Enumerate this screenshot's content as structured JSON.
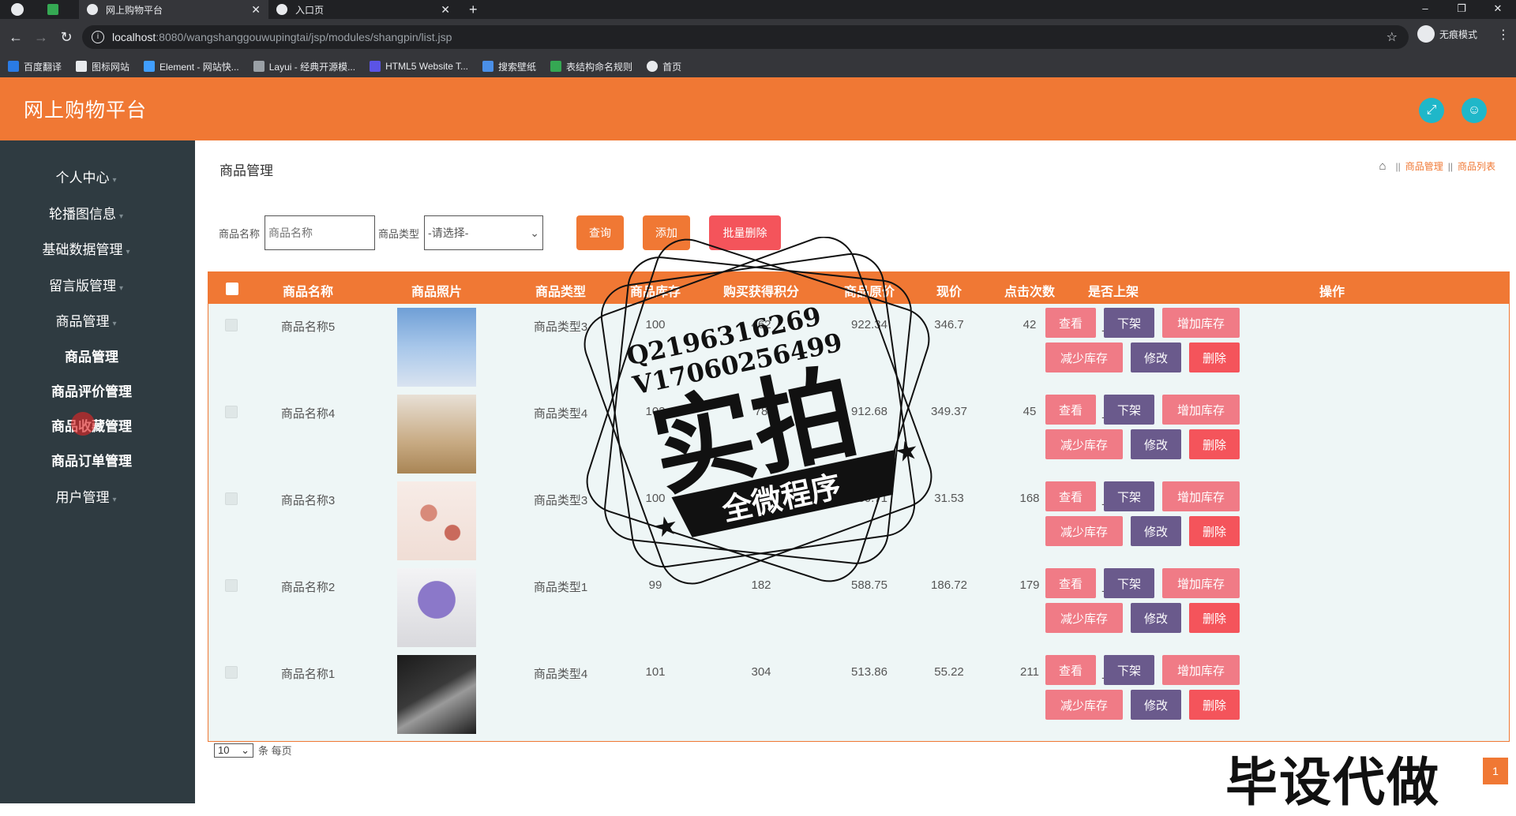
{
  "browser": {
    "tabs": [
      {
        "title": "网上购物平台",
        "active": true
      },
      {
        "title": "入口页",
        "active": false
      }
    ],
    "url_host": "localhost",
    "url_path": ":8080/wangshanggouwupingtai/jsp/modules/shangpin/list.jsp",
    "incognito_label": "无痕模式",
    "bookmarks": [
      "百度翻译",
      "图标网站",
      "Element - 网站快...",
      "Layui - 经典开源模...",
      "HTML5 Website T...",
      "搜索壁纸",
      "表结构命名规则",
      "首页"
    ]
  },
  "app": {
    "title": "网上购物平台"
  },
  "sidebar": {
    "items": [
      {
        "label": "个人中心"
      },
      {
        "label": "轮播图信息"
      },
      {
        "label": "基础数据管理"
      },
      {
        "label": "留言版管理"
      },
      {
        "label": "商品管理"
      },
      {
        "label": "商品管理"
      },
      {
        "label": "商品评价管理"
      },
      {
        "label": "商品收藏管理"
      },
      {
        "label": "商品订单管理"
      },
      {
        "label": "用户管理"
      }
    ]
  },
  "main": {
    "page_title": "商品管理",
    "breadcrumb": [
      "商品管理",
      "商品列表"
    ],
    "search": {
      "name_label": "商品名称",
      "name_placeholder": "商品名称",
      "type_label": "商品类型",
      "type_selected": "-请选择-",
      "query_btn": "查询",
      "add_btn": "添加",
      "batch_delete_btn": "批量删除"
    },
    "table": {
      "headers": [
        "商品名称",
        "商品照片",
        "商品类型",
        "商品库存",
        "购买获得积分",
        "商品原价",
        "现价",
        "点击次数",
        "是否上架",
        "操作"
      ],
      "rows": [
        {
          "name": "商品名称5",
          "type": "商品类型3",
          "stock": "100",
          "points": "462",
          "orig_price": "922.34",
          "price": "346.7",
          "clicks": "42",
          "status": "上架"
        },
        {
          "name": "商品名称4",
          "type": "商品类型4",
          "stock": "102",
          "points": "78",
          "orig_price": "912.68",
          "price": "349.37",
          "clicks": "45",
          "status": "上架"
        },
        {
          "name": "商品名称3",
          "type": "商品类型3",
          "stock": "100",
          "points": "355",
          "orig_price": "730.71",
          "price": "31.53",
          "clicks": "168",
          "status": "上架"
        },
        {
          "name": "商品名称2",
          "type": "商品类型1",
          "stock": "99",
          "points": "182",
          "orig_price": "588.75",
          "price": "186.72",
          "clicks": "179",
          "status": "上架"
        },
        {
          "name": "商品名称1",
          "type": "商品类型4",
          "stock": "101",
          "points": "304",
          "orig_price": "513.86",
          "price": "55.22",
          "clicks": "211",
          "status": "上架"
        }
      ],
      "ops": {
        "view": "查看",
        "off_shelf": "下架",
        "add_stock": "增加库存",
        "reduce_stock": "减少库存",
        "edit": "修改",
        "delete": "删除"
      }
    },
    "pager": {
      "page_size": "10",
      "per_page_label": "条 每页",
      "current_page": "1"
    }
  },
  "overlay": {
    "stamp_line1": "Q2196316269",
    "stamp_line2": "V17060256499",
    "stamp_big": "实拍",
    "stamp_banner": "全微程序",
    "corner_text": "毕设代做"
  },
  "colors": {
    "accent": "#f07834",
    "sidebar_bg": "#2f3b41",
    "danger": "#f4545b",
    "purple": "#6a5a8c",
    "pink": "#f07b86",
    "teal": "#1fb7c9"
  }
}
